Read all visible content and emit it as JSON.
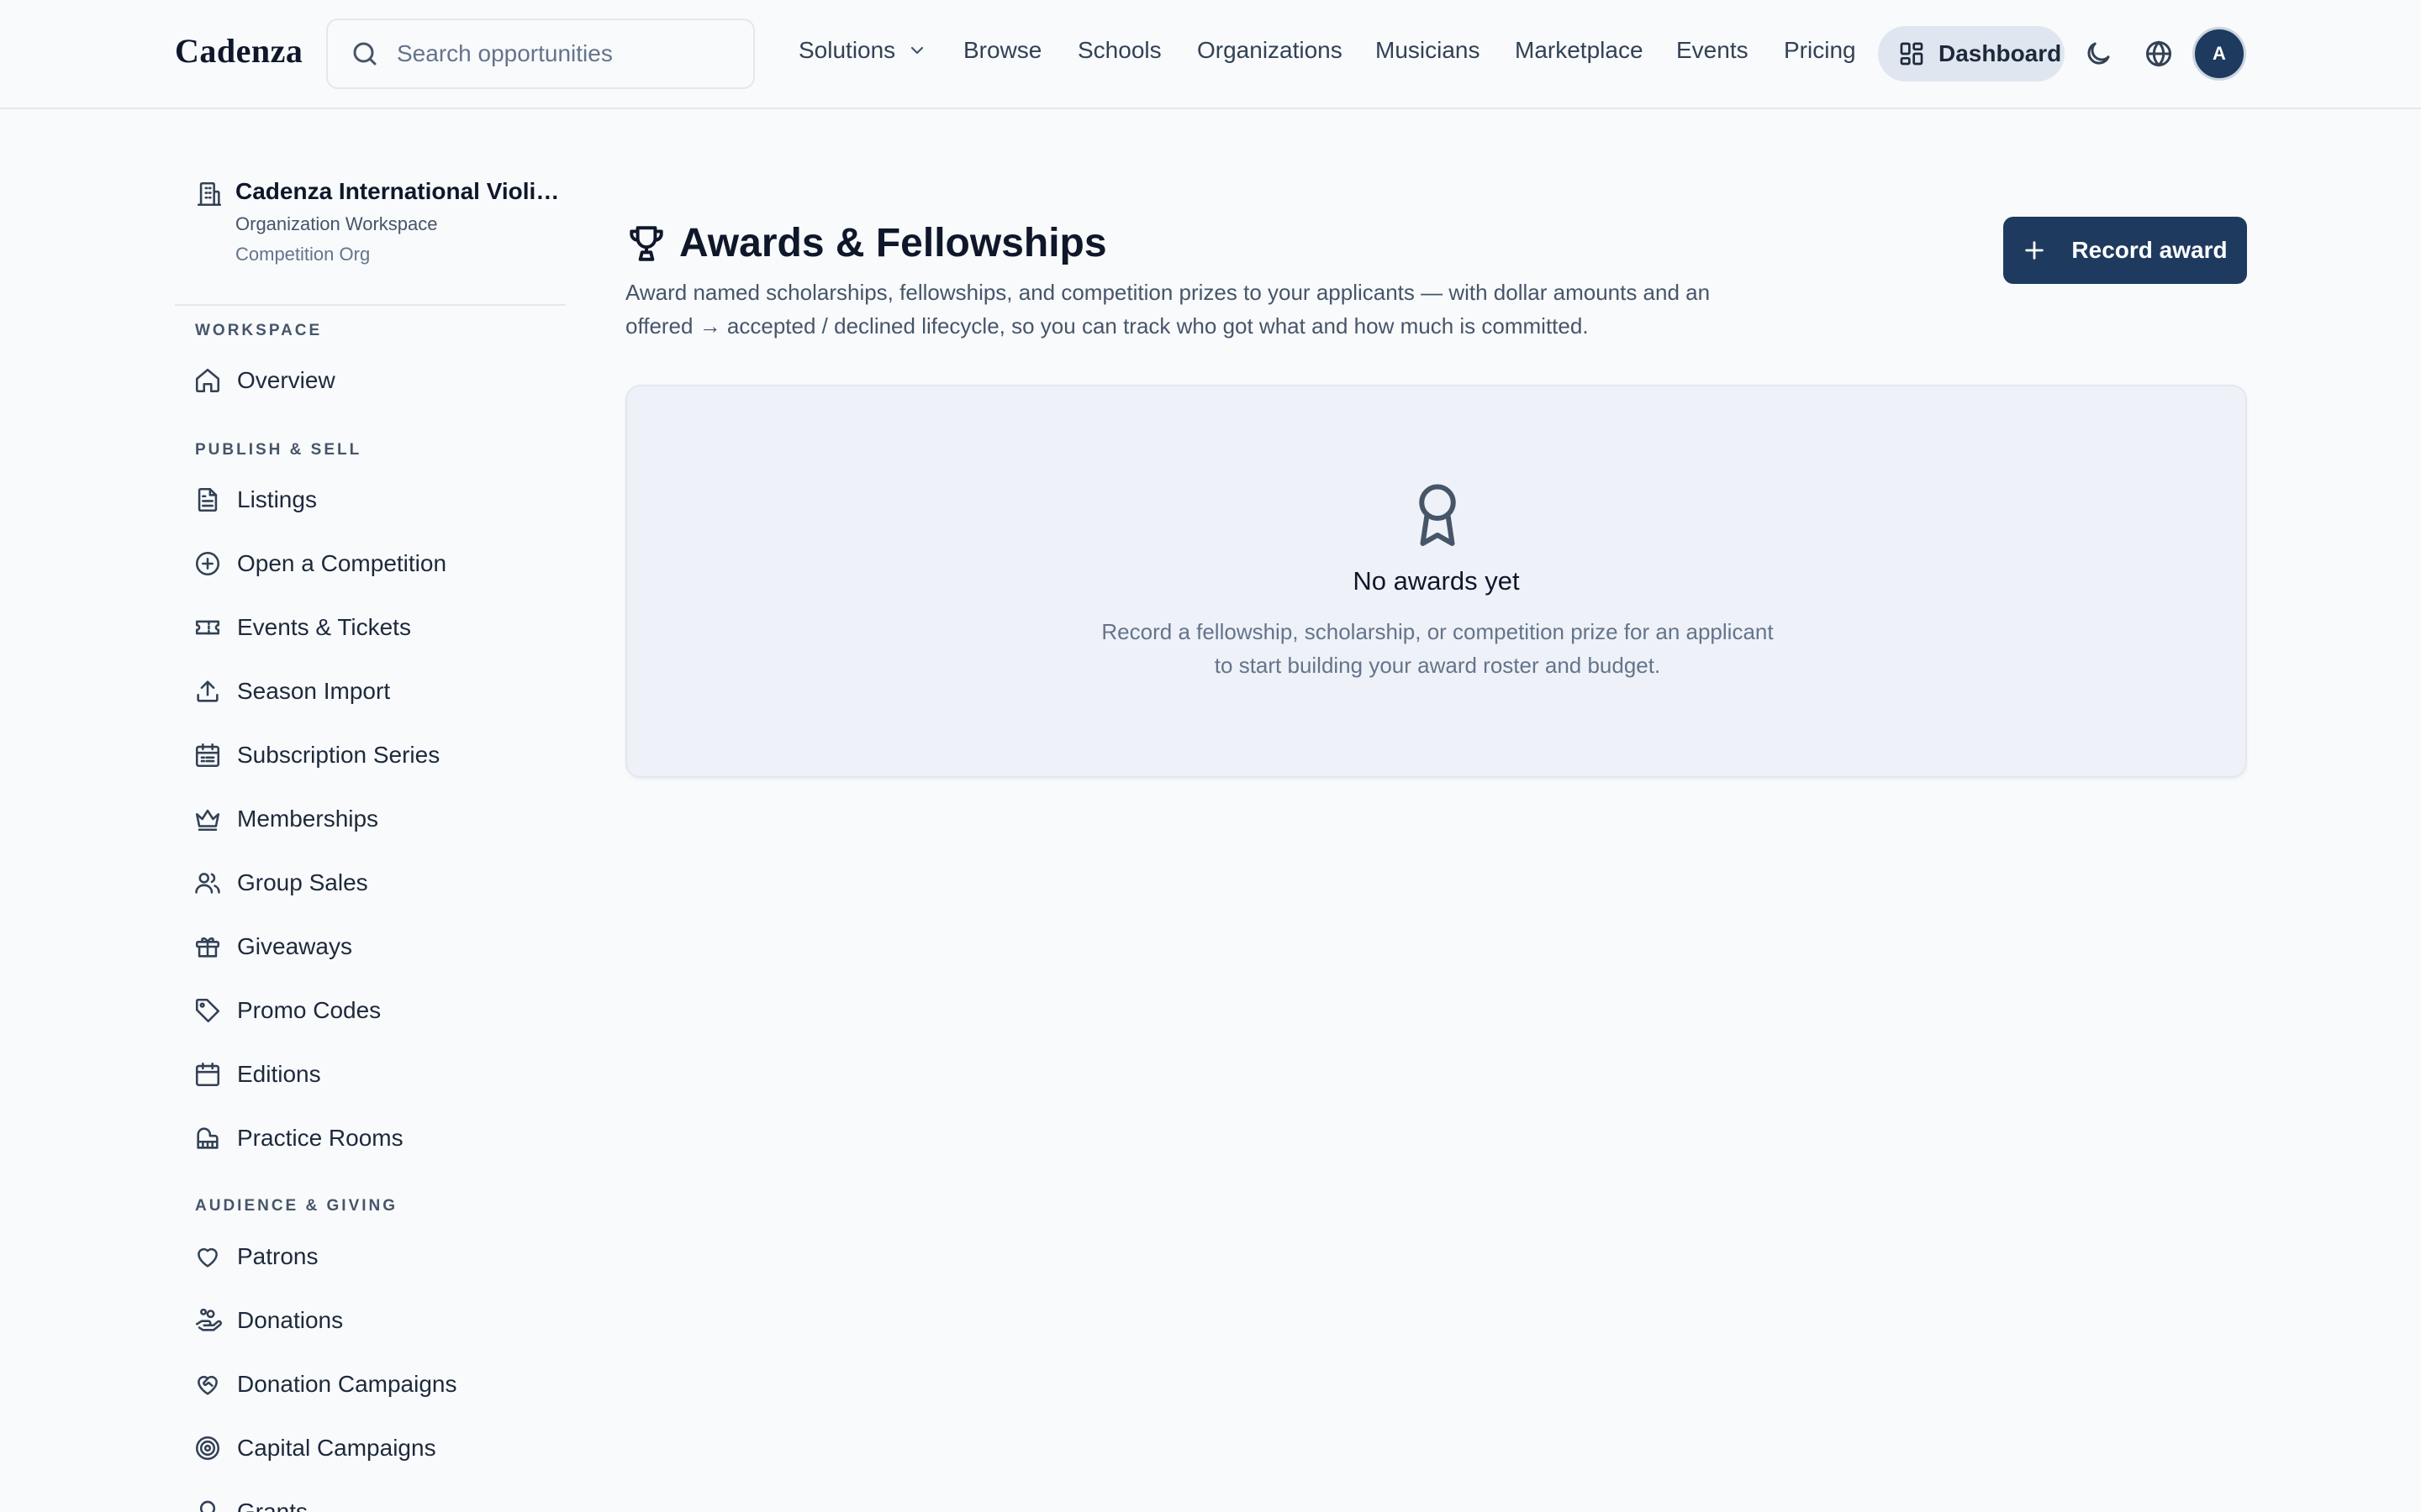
{
  "header": {
    "logo": "Cadenza",
    "search_placeholder": "Search opportunities",
    "nav": {
      "solutions": "Solutions",
      "browse": "Browse",
      "schools": "Schools",
      "organizations": "Organizations",
      "musicians": "Musicians",
      "marketplace": "Marketplace",
      "events": "Events",
      "pricing": "Pricing"
    },
    "dashboard_label": "Dashboard",
    "avatar_initial": "A"
  },
  "sidebar": {
    "org": {
      "name": "Cadenza International Violin Competition",
      "type": "Organization Workspace",
      "role": "Competition Org"
    },
    "sections": {
      "workspace": "Workspace",
      "publish_sell": "Publish & Sell",
      "audience_giving": "Audience & Giving"
    },
    "items": {
      "overview": "Overview",
      "listings": "Listings",
      "open_competition": "Open a Competition",
      "events_tickets": "Events & Tickets",
      "season_import": "Season Import",
      "subscription_series": "Subscription Series",
      "memberships": "Memberships",
      "group_sales": "Group Sales",
      "giveaways": "Giveaways",
      "promo_codes": "Promo Codes",
      "editions": "Editions",
      "practice_rooms": "Practice Rooms",
      "patrons": "Patrons",
      "donations": "Donations",
      "donation_campaigns": "Donation Campaigns",
      "capital_campaigns": "Capital Campaigns",
      "grants": "Grants"
    }
  },
  "main": {
    "title": "Awards & Fellowships",
    "description": "Award named scholarships, fellowships, and competition prizes to your applicants — with dollar amounts and an offered → accepted / declined lifecycle, so you can track who got what and how much is committed.",
    "record_button": "Record award",
    "empty": {
      "title": "No awards yet",
      "text": "Record a fellowship, scholarship, or competition prize for an applicant to start building your award roster and budget."
    }
  },
  "colors": {
    "primary": "#1e3a5f",
    "background": "#f8fafc",
    "card": "#eef2f8",
    "dashboard_pill": "#dfe6ef"
  }
}
